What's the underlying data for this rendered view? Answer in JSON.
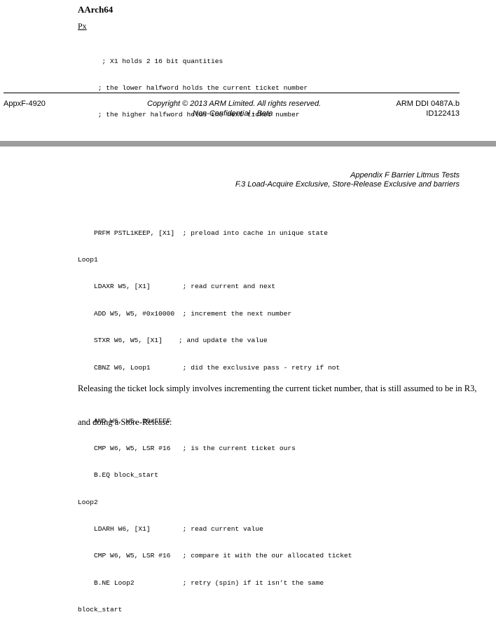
{
  "top": {
    "heading": "AArch64",
    "subheading": "Px",
    "code": [
      "      ; X1 holds 2 16 bit quantities",
      "     ; the lower halfword holds the current ticket number",
      "     ; the higher halfword holds the next ticket number"
    ]
  },
  "footer": {
    "left": "AppxF-4920",
    "center_line1": "Copyright © 2013 ARM Limited. All rights reserved.",
    "center_line2": "Non-Confidential - Beta",
    "right_line1": "ARM DDI 0487A.b",
    "right_line2": "ID122413"
  },
  "page_header": {
    "line1": "Appendix F Barrier Litmus Tests",
    "line2": "F.3 Load-Acquire Exclusive, Store-Release Exclusive and barriers"
  },
  "code_block": [
    "    PRFM PSTL1KEEP, [X1]  ; preload into cache in unique state",
    "Loop1",
    "    LDAXR W5, [X1]        ; read current and next",
    "    ADD W5, W5, #0x10000  ; increment the next number",
    "    STXR W6, W5, [X1]    ; and update the value",
    "    CBNZ W6, Loop1        ; did the exclusive pass - retry if not",
    "",
    "    AND W6, W5, #0xFFFF",
    "    CMP W6, W5, LSR #16   ; is the current ticket ours",
    "    B.EQ block_start",
    "Loop2",
    "    LDARH W6, [X1]        ; read current value",
    "    CMP W6, W5, LSR #16   ; compare it with the our allocated ticket",
    "    B.NE Loop2            ; retry (spin) if it isn't the same",
    "block_start"
  ],
  "paragraph": {
    "line1": "Releasing the ticket lock simply involves incrementing the current ticket number, that is still assumed to be in R3,",
    "line2": "and doing a Store-Release:"
  }
}
